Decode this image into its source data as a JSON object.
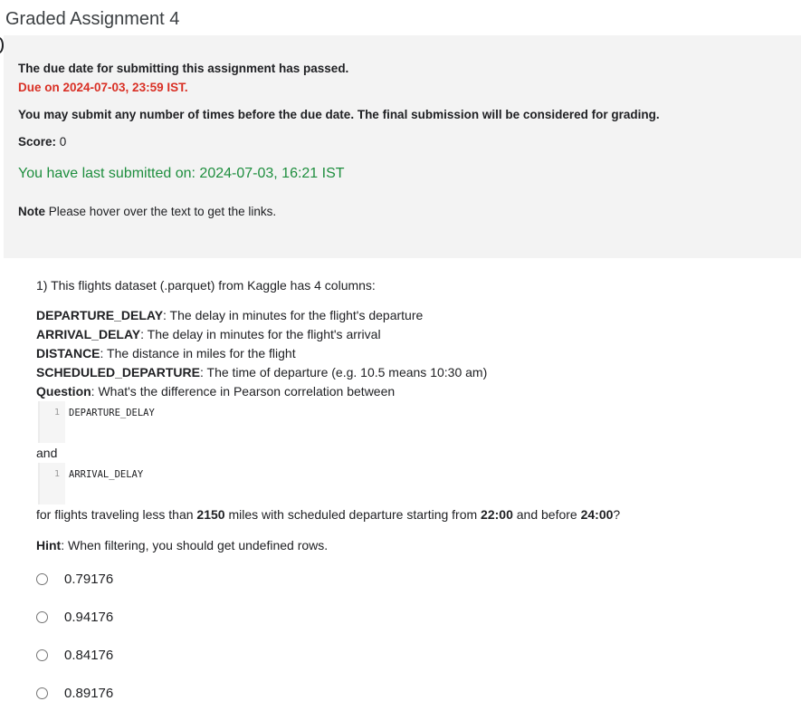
{
  "header": {
    "title": "Graded Assignment 4"
  },
  "info": {
    "due_passed": "The due date for submitting this assignment has passed.",
    "due_on": "Due on 2024-07-03, 23:59 IST.",
    "submit_note": "You may submit any number of times before the due date. The final submission will be considered for grading.",
    "score_label": "Score:",
    "score_value": "0",
    "last_submitted": "You have last submitted on: 2024-07-03, 16:21 IST",
    "note_label": "Note",
    "note_text": "Please hover over the text to get the links."
  },
  "question": {
    "intro": "1) This flights dataset (.parquet) from Kaggle has 4 columns:",
    "columns": [
      {
        "name": "DEPARTURE_DELAY",
        "desc": ": The delay in minutes for the flight's departure"
      },
      {
        "name": "ARRIVAL_DELAY",
        "desc": ": The delay in minutes for the flight's arrival"
      },
      {
        "name": "DISTANCE",
        "desc": ": The distance in miles for the flight"
      },
      {
        "name": "SCHEDULED_DEPARTURE",
        "desc": ": The time of departure (e.g. 10.5 means 10:30 am)"
      }
    ],
    "question_label": "Question",
    "question_text": ": What's the difference in Pearson correlation between",
    "code1": {
      "line": "1",
      "text": "DEPARTURE_DELAY"
    },
    "and_text": "and",
    "code2": {
      "line": "1",
      "text": "ARRIVAL_DELAY"
    },
    "filter_pre": "for flights traveling less than ",
    "filter_miles": "2150",
    "filter_mid": " miles with scheduled departure starting from ",
    "filter_start": "22:00",
    "filter_and": " and before ",
    "filter_end": "24:00",
    "filter_post": "?",
    "hint_label": "Hint",
    "hint_text": ": When filtering, you should get undefined rows.",
    "options": [
      "0.79176",
      "0.94176",
      "0.84176",
      "0.89176"
    ]
  }
}
